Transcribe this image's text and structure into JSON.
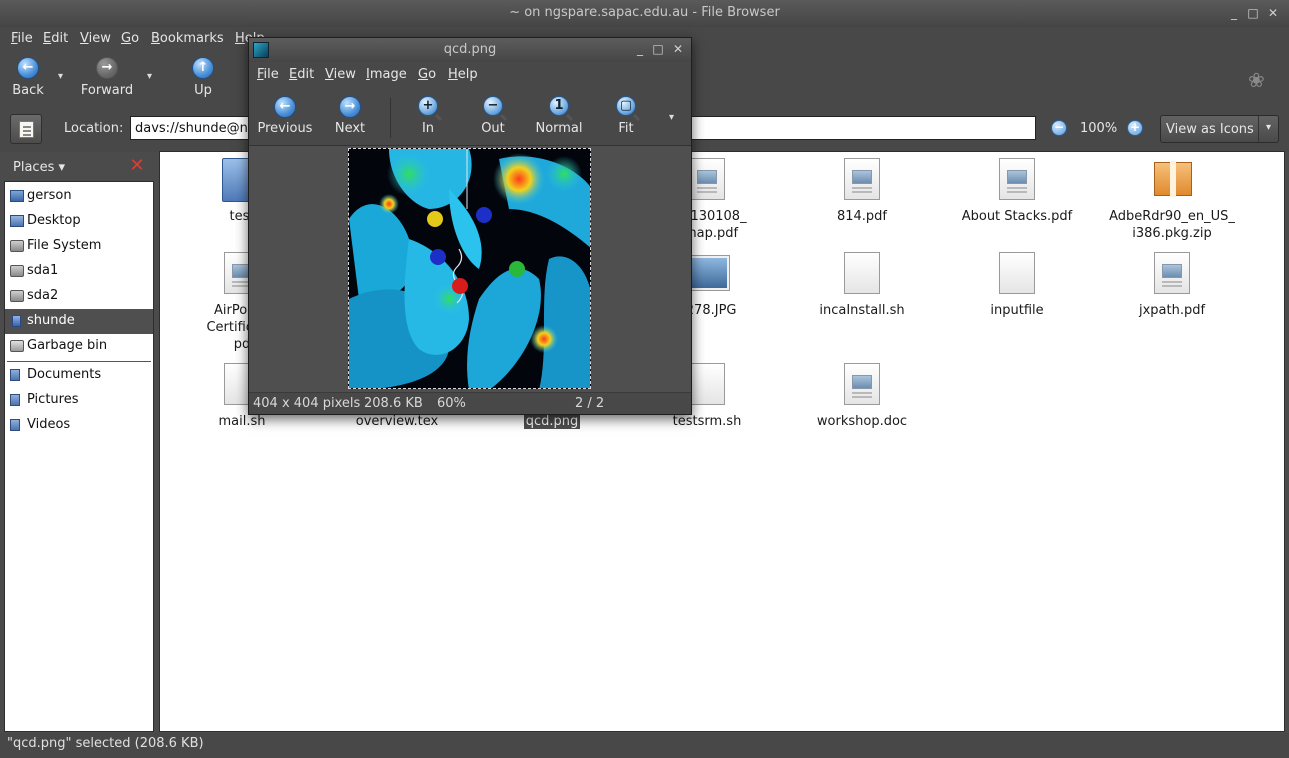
{
  "browser": {
    "title": "~ on ngspare.sapac.edu.au - File Browser",
    "menu": [
      "File",
      "Edit",
      "View",
      "Go",
      "Bookmarks",
      "Help"
    ],
    "toolbar": {
      "back": "Back",
      "forward": "Forward",
      "up": "Up"
    },
    "location": {
      "label": "Location:",
      "value": "davs://shunde@ngspare.sapac.edu.au/"
    },
    "zoom": "100%",
    "view_mode": "View as Icons",
    "status": "\"qcd.png\" selected (208.6 KB)"
  },
  "sidebar": {
    "header": "Places",
    "items": [
      {
        "label": "gerson",
        "icon": "home-folder-icon"
      },
      {
        "label": "Desktop",
        "icon": "desktop-icon"
      },
      {
        "label": "File System",
        "icon": "drive-icon"
      },
      {
        "label": "sda1",
        "icon": "drive-icon"
      },
      {
        "label": "sda2",
        "icon": "drive-icon"
      },
      {
        "label": "shunde",
        "icon": "network-icon",
        "selected": true
      },
      {
        "label": "Garbage bin",
        "icon": "trash-icon"
      },
      {
        "label": "Documents",
        "icon": "folder-icon"
      },
      {
        "label": "Pictures",
        "icon": "folder-icon"
      },
      {
        "label": "Videos",
        "icon": "folder-icon"
      }
    ]
  },
  "files": [
    {
      "name": "test",
      "type": "folder"
    },
    {
      "name": "27_130108_\nemap.pdf",
      "type": "doc"
    },
    {
      "name": "814.pdf",
      "type": "doc"
    },
    {
      "name": "About Stacks.pdf",
      "type": "doc"
    },
    {
      "name": "AdbeRdr90_en_US_\ni386.pkg.zip",
      "type": "package"
    },
    {
      "name": "AirPort E\nCertificatio\npd",
      "type": "doc"
    },
    {
      "name": "1278.JPG",
      "type": "image"
    },
    {
      "name": "incaInstall.sh",
      "type": "blank"
    },
    {
      "name": "inputfile",
      "type": "blank"
    },
    {
      "name": "jxpath.pdf",
      "type": "doc"
    },
    {
      "name": "mail.sh",
      "type": "blank"
    },
    {
      "name": "overview.tex",
      "type": "blank"
    },
    {
      "name": "qcd.png",
      "type": "image",
      "selected": true
    },
    {
      "name": "testsrm.sh",
      "type": "blank"
    },
    {
      "name": "workshop.doc",
      "type": "doc"
    }
  ],
  "viewer": {
    "title": "qcd.png",
    "menu": [
      "File",
      "Edit",
      "View",
      "Image",
      "Go",
      "Help"
    ],
    "toolbar": {
      "previous": "Previous",
      "next": "Next",
      "in": "In",
      "out": "Out",
      "normal": "Normal",
      "fit": "Fit"
    },
    "status": {
      "dimensions": "404 x 404 pixels",
      "size": "208.6 KB",
      "zoom": "60%",
      "position": "2 / 2"
    }
  }
}
